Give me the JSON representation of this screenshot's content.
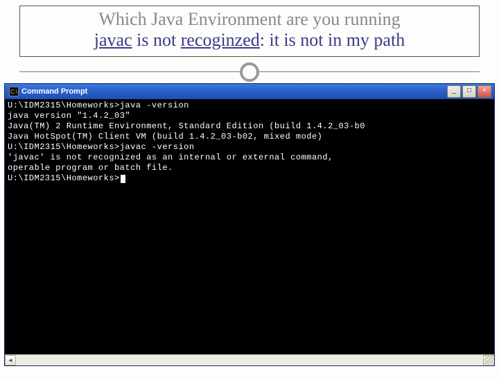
{
  "slide": {
    "title": "Which Java Environment are you running",
    "sub_a": "javac",
    "sub_b": " is not ",
    "sub_c": "recoginzed",
    "sub_d": ": it is not in my path"
  },
  "window": {
    "title": "Command Prompt",
    "icon_glyph": "C:\\",
    "buttons": {
      "min": "_",
      "max": "□",
      "close": "×"
    }
  },
  "terminal": {
    "blank0": "",
    "line1": "U:\\IDM2315\\Homeworks>java -version",
    "line2": "java version \"1.4.2_03\"",
    "line3": "Java(TM) 2 Runtime Environment, Standard Edition (build 1.4.2_03-b0",
    "line4": "Java HotSpot(TM) Client VM (build 1.4.2_03-b02, mixed mode)",
    "blank1": "",
    "line5": "U:\\IDM2315\\Homeworks>javac -version",
    "line6": "'javac' is not recognized as an internal or external command,",
    "line7": "operable program or batch file.",
    "blank2": "",
    "line8": "U:\\IDM2315\\Homeworks>"
  },
  "scrollbar": {
    "left": "◄",
    "right": "►"
  }
}
